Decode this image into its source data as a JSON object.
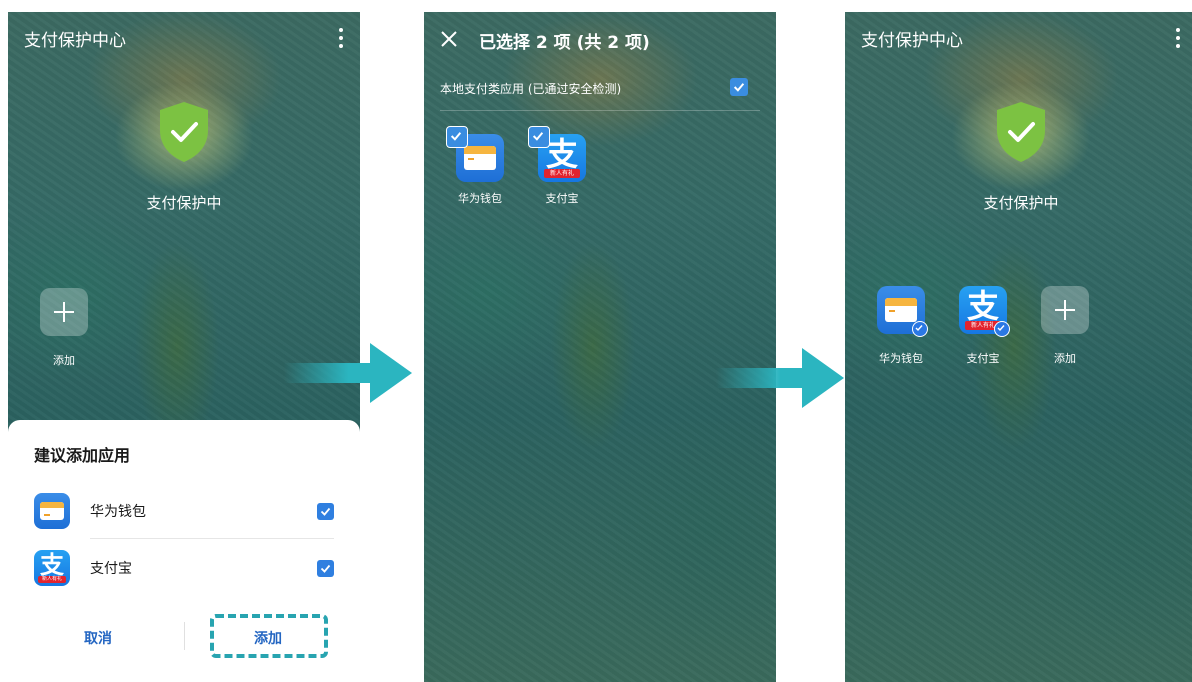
{
  "screen1": {
    "title": "支付保护中心",
    "status": "支付保护中",
    "add_label": "添加",
    "sheet": {
      "title": "建议添加应用",
      "apps": [
        {
          "name": "华为钱包",
          "checked": true
        },
        {
          "name": "支付宝",
          "checked": true
        }
      ],
      "cancel": "取消",
      "add": "添加"
    }
  },
  "screen2": {
    "title": "已选择 2 项 (共 2 项)",
    "section": "本地支付类应用 (已通过安全检测)",
    "apps": [
      {
        "name": "华为钱包"
      },
      {
        "name": "支付宝"
      }
    ]
  },
  "screen3": {
    "title": "支付保护中心",
    "status": "支付保护中",
    "apps": [
      {
        "name": "华为钱包"
      },
      {
        "name": "支付宝"
      }
    ],
    "add_label": "添加"
  },
  "icons": {
    "alipay_glyph": "支",
    "alipay_ribbon": "新人有礼"
  },
  "colors": {
    "shield": "#7cc242",
    "accent": "#2f7fe0",
    "highlight": "#28a4b0",
    "arrow": "#2bb5c0"
  }
}
